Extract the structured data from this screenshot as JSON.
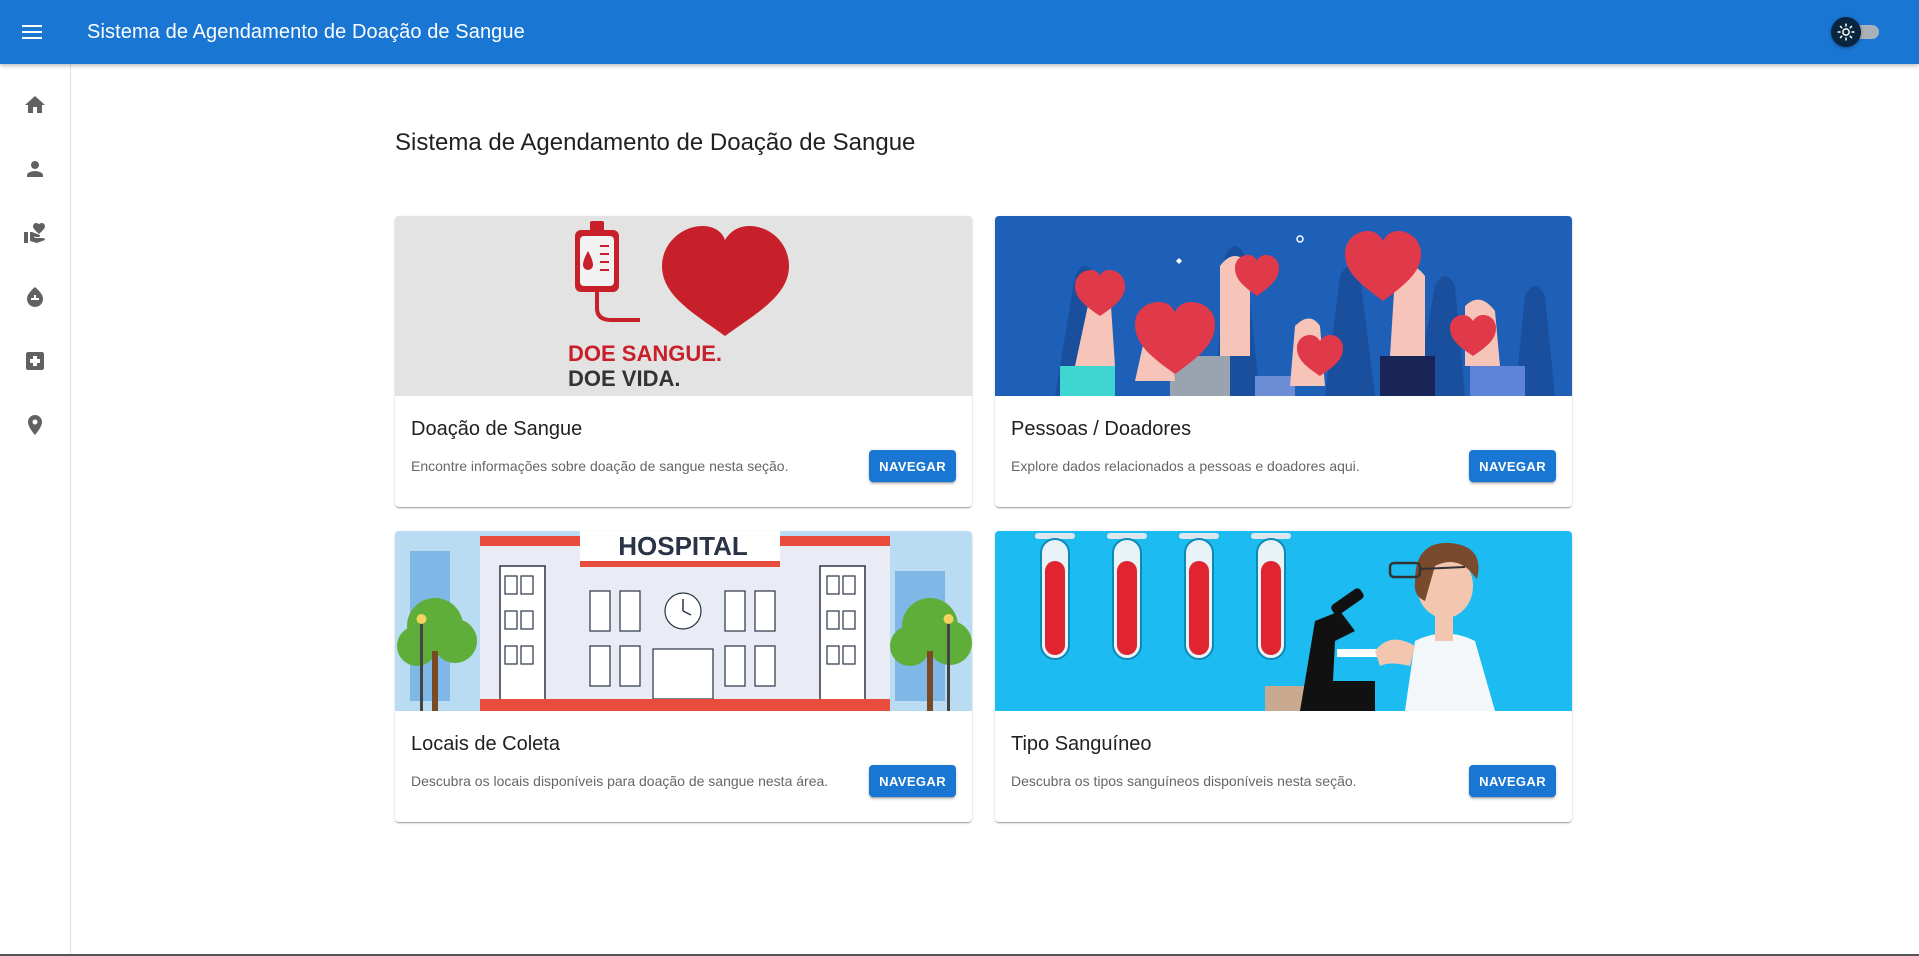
{
  "appbar": {
    "title": "Sistema de Agendamento de Doação de Sangue",
    "menu_icon": "menu-icon",
    "theme_toggle_icon": "sun-icon"
  },
  "sidebar": {
    "items": [
      {
        "name": "home",
        "icon": "home-icon"
      },
      {
        "name": "person",
        "icon": "person-icon"
      },
      {
        "name": "volunteer",
        "icon": "volunteer-heart-icon"
      },
      {
        "name": "blood-drop",
        "icon": "blood-drop-icon"
      },
      {
        "name": "medical",
        "icon": "medical-cross-icon"
      },
      {
        "name": "location",
        "icon": "location-pin-icon"
      }
    ]
  },
  "main": {
    "page_title": "Sistema de Agendamento de Doação de Sangue",
    "cards": [
      {
        "title": "Doação de Sangue",
        "description": "Encontre informações sobre doação de sangue nesta seção.",
        "button": "NAVEGAR",
        "image_text_1": "DOE SANGUE.",
        "image_text_2": "DOE VIDA."
      },
      {
        "title": "Pessoas / Doadores",
        "description": "Explore dados relacionados a pessoas e doadores aqui.",
        "button": "NAVEGAR"
      },
      {
        "title": "Locais de Coleta",
        "description": "Descubra os locais disponíveis para doação de sangue nesta área.",
        "button": "NAVEGAR",
        "image_text_1": "HOSPITAL"
      },
      {
        "title": "Tipo Sanguíneo",
        "description": "Descubra os tipos sanguíneos disponíveis nesta seção.",
        "button": "NAVEGAR"
      }
    ]
  },
  "colors": {
    "primary": "#1976d2",
    "blood_red": "#c8202a",
    "toggle_thumb": "#0a2540"
  }
}
